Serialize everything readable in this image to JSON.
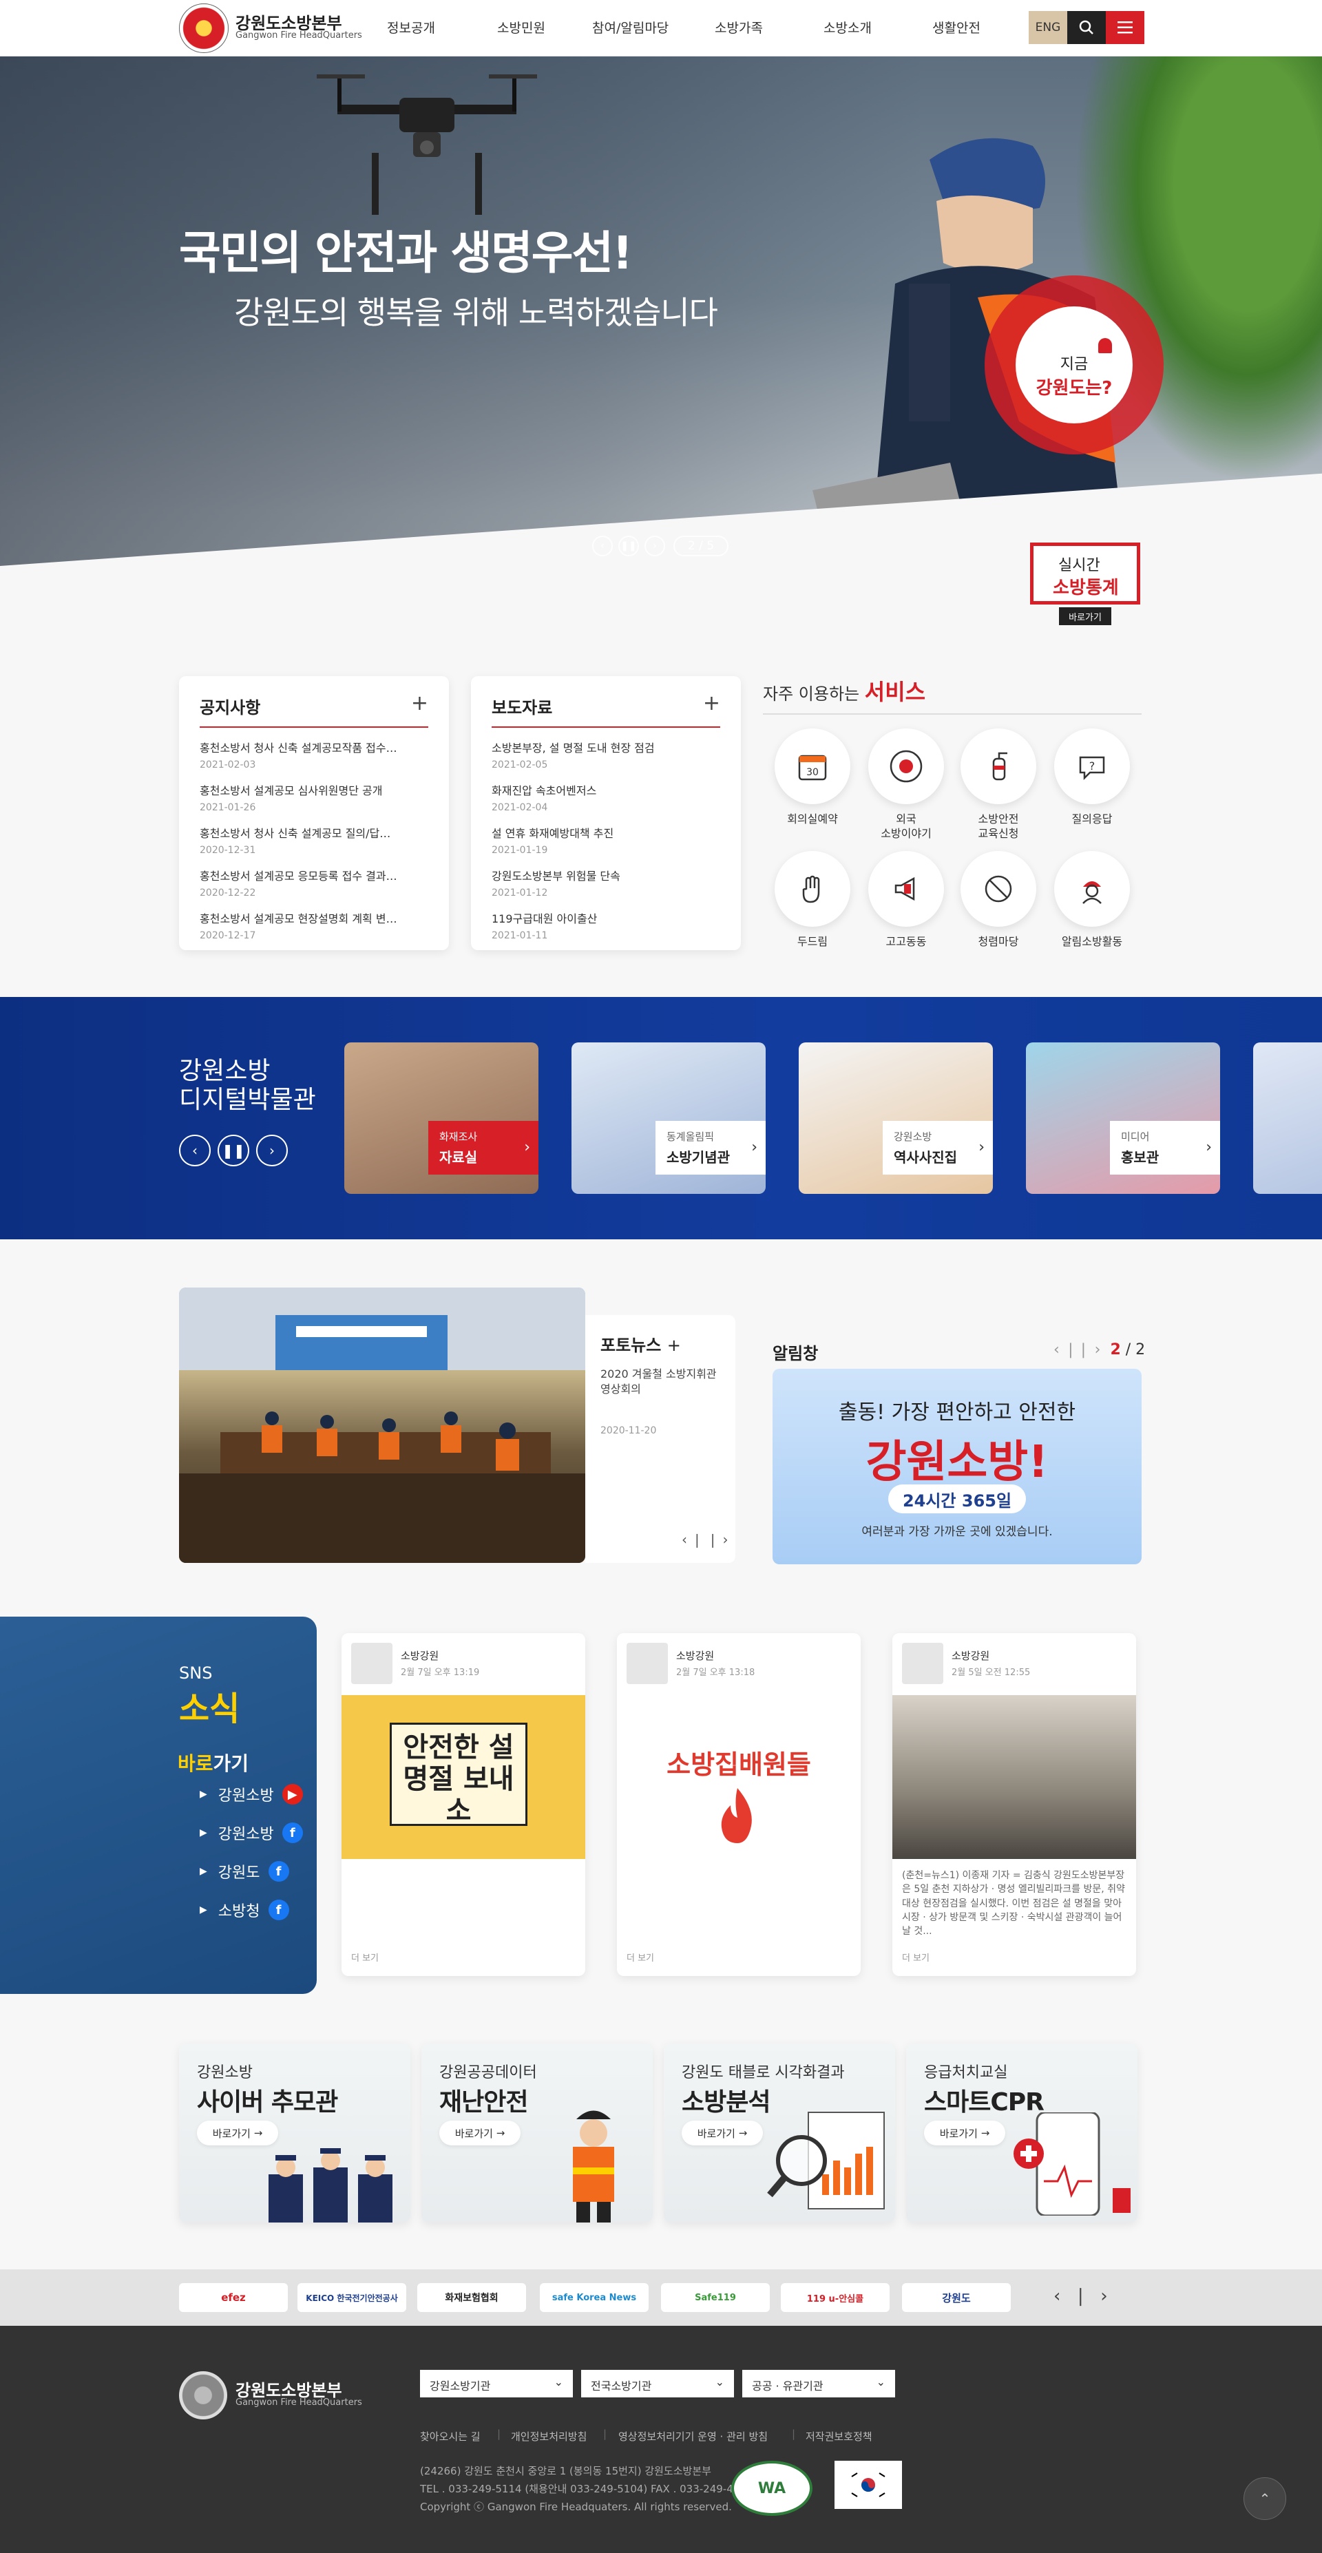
{
  "header": {
    "logo_title": "강원도소방본부",
    "logo_sub": "Gangwon Fire HeadQuarters",
    "nav": [
      "정보공개",
      "소방민원",
      "참여/알림마당",
      "소방가족",
      "소방소개",
      "생활안전"
    ],
    "eng_label": "ENG"
  },
  "hero": {
    "headline": "국민의 안전과 생명우선!",
    "subline": "강원도의 행복을 위해 노력하겠습니다",
    "page": "2 / 5",
    "now_l1": "지금",
    "now_l2": "강원도는?",
    "stats_l1": "실시간",
    "stats_l2": "소방통계",
    "stats_btn": "바로가기"
  },
  "notice": {
    "title": "공지사항",
    "items": [
      {
        "title": "홍천소방서 청사 신축 설계공모작품 접수…",
        "date": "2021-02-03"
      },
      {
        "title": "홍천소방서 설계공모 심사위원명단 공개",
        "date": "2021-01-26"
      },
      {
        "title": "홍천소방서 청사 신축 설계공모 질의/답…",
        "date": "2020-12-31"
      },
      {
        "title": "홍천소방서 설계공모 응모등록 접수 결과…",
        "date": "2020-12-22"
      },
      {
        "title": "홍천소방서 설계공모 현장설명회 계획 변…",
        "date": "2020-12-17"
      }
    ]
  },
  "press": {
    "title": "보도자료",
    "items": [
      {
        "title": "소방본부장, 설 명절 도내 현장 점검",
        "date": "2021-02-05"
      },
      {
        "title": "화재진압 속초어벤저스",
        "date": "2021-02-04"
      },
      {
        "title": "설 연휴 화재예방대책 추진",
        "date": "2021-01-19"
      },
      {
        "title": "강원도소방본부 위험물 단속",
        "date": "2021-01-12"
      },
      {
        "title": "119구급대원 아이출산",
        "date": "2021-01-11"
      }
    ]
  },
  "services": {
    "title_pre": "자주 이용하는",
    "title_em": "서비스",
    "items": [
      {
        "label": "회의실예약",
        "icon": "calendar-icon"
      },
      {
        "label": "외국\n소방이야기",
        "icon": "siren-icon"
      },
      {
        "label": "소방안전\n교육신청",
        "icon": "extinguisher-icon"
      },
      {
        "label": "질의응답",
        "icon": "question-bubble-icon"
      },
      {
        "label": "두드림",
        "icon": "hand-icon"
      },
      {
        "label": "고고동동",
        "icon": "megaphone-icon"
      },
      {
        "label": "청렴마당",
        "icon": "no-bribe-icon"
      },
      {
        "label": "알림소방활동",
        "icon": "firefighter-icon"
      }
    ]
  },
  "museum": {
    "title_l1": "강원소방",
    "title_l2": "디지털박물관",
    "cards": [
      {
        "sub": "화재조사",
        "name": "자료실"
      },
      {
        "sub": "동계올림픽",
        "name": "소방기념관"
      },
      {
        "sub": "강원소방",
        "name": "역사사진집"
      },
      {
        "sub": "미디어",
        "name": "홍보관"
      }
    ]
  },
  "photo_news": {
    "title": "포토뉴스",
    "desc": "2020 겨울철 소방지휘관 영상회의",
    "date": "2020-11-20"
  },
  "alarm": {
    "title": "알림창",
    "page_current": "2",
    "page_total": "2",
    "banner_l1": "출동! 가장 편안하고 안전한",
    "banner_l2": "강원소방!",
    "banner_l3": "24시간 365일",
    "banner_l4": "여러분과 가장 가까운 곳에 있겠습니다."
  },
  "sns": {
    "k1": "SNS",
    "k2": "소식",
    "go_pre": "바로",
    "go_post": "가기",
    "links": [
      {
        "label": "강원소방",
        "icon": "youtube-icon",
        "color": "#e62117"
      },
      {
        "label": "강원소방",
        "icon": "facebook-icon",
        "color": "#1877f2"
      },
      {
        "label": "강원도",
        "icon": "facebook-icon",
        "color": "#1877f2"
      },
      {
        "label": "소방청",
        "icon": "facebook-icon",
        "color": "#1877f2"
      }
    ],
    "posts": [
      {
        "name": "소방강원",
        "time": "2월 7일 오후 13:19",
        "text": "",
        "more": "더 보기"
      },
      {
        "name": "소방강원",
        "time": "2월 7일 오후 13:18",
        "text": "",
        "more": "더 보기"
      },
      {
        "name": "소방강원",
        "time": "2월 5일 오전 12:55",
        "text": "(춘천=뉴스1) 이종재 기자 = 김충식 강원도소방본부장은 5일 춘천 지하상가 · 명성 엘리빌리파크를 방문, 취약대상 현장점검을 실시했다. 이번 점검은 설 명절을 맞아 시장 · 상가 방문객 및 스키장 · 숙박시설 관광객이 늘어날 것...",
        "more": "더 보기"
      }
    ],
    "post1_img": "안전한 설 명절 보내소",
    "post2_img": "소방집배원들"
  },
  "features": [
    {
      "sub": "강원소방",
      "title": "사이버 추모관",
      "btn": "바로가기"
    },
    {
      "sub": "강원공공데이터",
      "title": "재난안전",
      "btn": "바로가기"
    },
    {
      "sub": "강원도 태블로 시각화결과",
      "title": "소방분석",
      "btn": "바로가기"
    },
    {
      "sub": "응급처치교실",
      "title": "스마트CPR",
      "btn": "바로가기"
    }
  ],
  "partners": [
    "efez",
    "KEICO 한국전기안전공사",
    "화재보험협회",
    "safe Korea News",
    "Safe119",
    "119 u-안심콜",
    "강원도"
  ],
  "footer": {
    "title": "강원도소방본부",
    "sub": "Gangwon Fire HeadQuarters",
    "selects": [
      "강원소방기관",
      "전국소방기관",
      "공공 · 유관기관"
    ],
    "links": [
      "찾아오시는 길",
      "개인정보처리방침",
      "영상정보처리기기 운영 · 관리 방침",
      "저작권보호정책"
    ],
    "address": "(24266) 강원도 춘천시 중앙로 1 (봉의동 15번지) 강원도소방본부",
    "tel": "TEL . 033-249-5114 (채용안내 033-249-5104) FAX . 033-249-4065",
    "copyright": "Copyright ⓒ Gangwon Fire Headquaters. All rights reserved.",
    "wa_label": "WA"
  }
}
